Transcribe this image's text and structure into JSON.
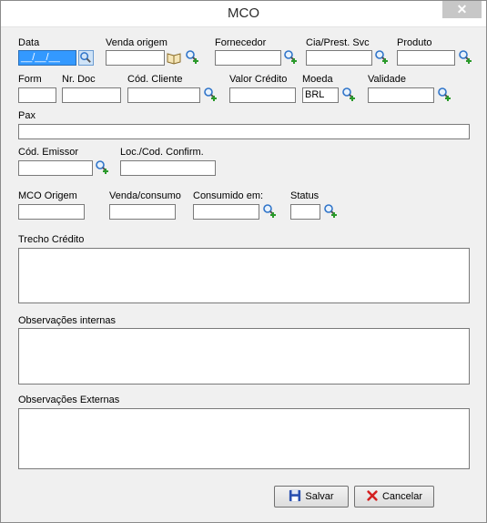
{
  "window": {
    "title": "MCO",
    "close_glyph": "✕"
  },
  "fields": {
    "data": {
      "label": "Data",
      "value": "__/__/__"
    },
    "venda_origem": {
      "label": "Venda origem"
    },
    "fornecedor": {
      "label": "Fornecedor"
    },
    "cia_prest_svc": {
      "label": "Cia/Prest. Svc"
    },
    "produto": {
      "label": "Produto"
    },
    "form": {
      "label": "Form"
    },
    "nr_doc": {
      "label": "Nr. Doc"
    },
    "cod_cliente": {
      "label": "Cód. Cliente"
    },
    "valor_credito": {
      "label": "Valor Crédito"
    },
    "moeda": {
      "label": "Moeda",
      "value": "BRL"
    },
    "validade": {
      "label": "Validade"
    },
    "pax": {
      "label": "Pax"
    },
    "cod_emissor": {
      "label": "Cód. Emissor"
    },
    "loc_cod_confirm": {
      "label": "Loc./Cod. Confirm."
    },
    "mco_origem": {
      "label": "MCO Origem"
    },
    "venda_consumo": {
      "label": "Venda/consumo"
    },
    "consumido_em": {
      "label": "Consumido em:"
    },
    "status": {
      "label": "Status"
    },
    "trecho_credito": {
      "label": "Trecho Crédito"
    },
    "obs_internas": {
      "label": "Observações internas"
    },
    "obs_externas": {
      "label": "Observações Externas"
    }
  },
  "buttons": {
    "salvar": {
      "label": "Salvar",
      "icon": "floppy-disk-icon"
    },
    "cancelar": {
      "label": "Cancelar",
      "icon": "red-x-icon"
    }
  },
  "icons": {
    "search": "search-add-icon",
    "book": "book-icon"
  },
  "colors": {
    "selection": "#3399ff",
    "search_lens": "#2f74c9",
    "plus": "#2a9a2a",
    "cancel_x": "#d42020",
    "save_disk": "#2a50b0"
  }
}
